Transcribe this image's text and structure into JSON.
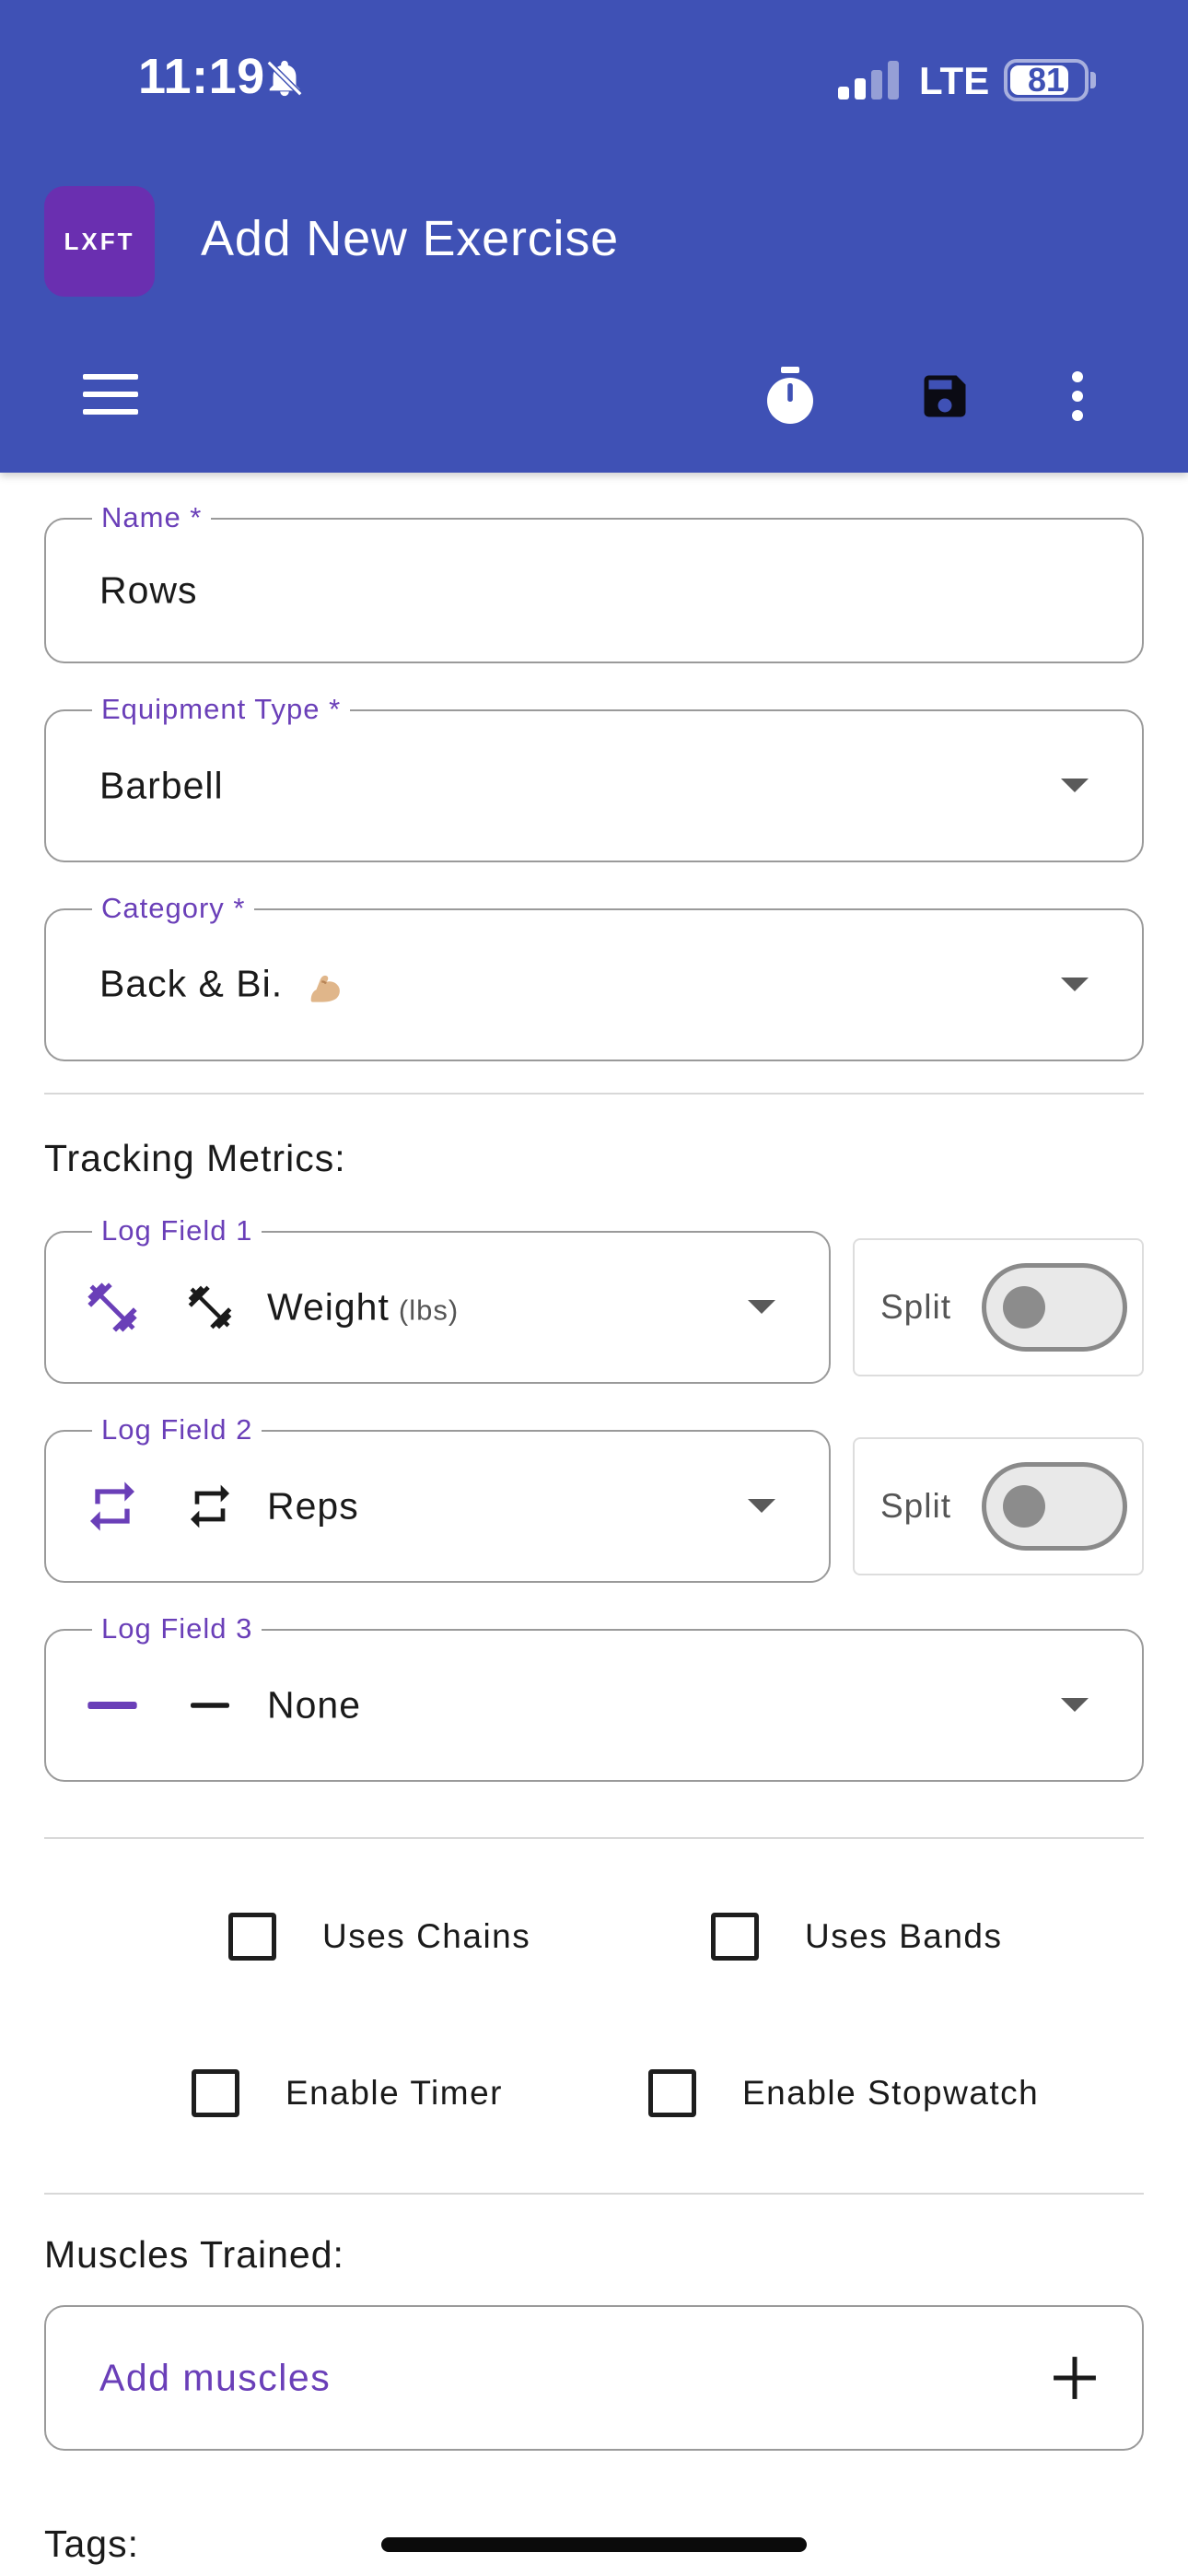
{
  "colors": {
    "brand": "#3f51b5",
    "accent": "#6a3fb8",
    "logo": "#6a2fb0"
  },
  "status_bar": {
    "time": "11:19",
    "network": "LTE",
    "battery": "81",
    "battery_level": 0.81
  },
  "app_bar": {
    "logo_text": "LXFT",
    "title": "Add New Exercise",
    "icons": [
      "menu-icon",
      "stopwatch-icon",
      "save-icon",
      "more-vert-icon"
    ]
  },
  "form": {
    "name": {
      "label": "Name *",
      "value": "Rows"
    },
    "equipment": {
      "label": "Equipment Type *",
      "value": "Barbell"
    },
    "category": {
      "label": "Category *",
      "value": "Back & Bi.",
      "emoji": "flexed-biceps-icon"
    }
  },
  "tracking": {
    "title": "Tracking Metrics:",
    "fields": [
      {
        "label": "Log Field 1",
        "value": "Weight",
        "unit": "(lbs)",
        "icon": "dumbbell-icon",
        "split_label": "Split",
        "split_on": false
      },
      {
        "label": "Log Field 2",
        "value": "Reps",
        "icon": "repeat-icon",
        "split_label": "Split",
        "split_on": false
      },
      {
        "label": "Log Field 3",
        "value": "None",
        "icon": "minus-icon"
      }
    ]
  },
  "options": {
    "uses_chains": {
      "label": "Uses Chains",
      "checked": false
    },
    "uses_bands": {
      "label": "Uses Bands",
      "checked": false
    },
    "enable_timer": {
      "label": "Enable Timer",
      "checked": false
    },
    "enable_stopwatch": {
      "label": "Enable Stopwatch",
      "checked": false
    }
  },
  "muscles": {
    "title": "Muscles Trained:",
    "placeholder": "Add muscles"
  },
  "tags": {
    "title": "Tags:"
  }
}
